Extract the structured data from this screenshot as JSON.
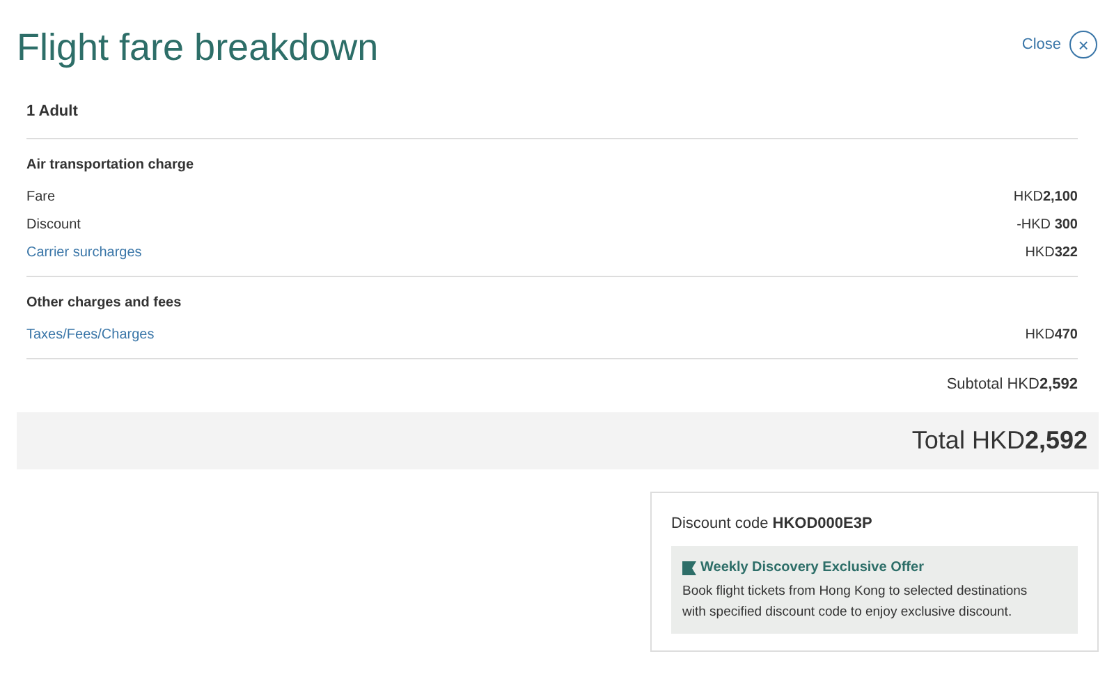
{
  "title": "Flight fare breakdown",
  "close": {
    "label": "Close",
    "icon": "×"
  },
  "passengers": "1 Adult",
  "sections": [
    {
      "heading": "Air transportation charge",
      "rows": [
        {
          "kind": "plain",
          "label": "Fare",
          "amount": "HKD**2,100**"
        },
        {
          "kind": "plain",
          "label": "Discount",
          "amount": "-HKD **300**"
        },
        {
          "kind": "link",
          "label": "Carrier surcharges",
          "amount": "HKD**322**"
        }
      ]
    },
    {
      "heading": "Other charges and fees",
      "rows": [
        {
          "kind": "link",
          "label": "Taxes/Fees/Charges",
          "amount": "HKD**470**"
        }
      ]
    }
  ],
  "subtotal": "Subtotal HKD**2,592**",
  "total": "Total HKD**2,592**",
  "discount": {
    "code": "Discount code **HKOD000E3P**",
    "offer_title": "Weekly Discovery Exclusive Offer",
    "offer_text": "Book flight tickets from Hong Kong to selected destinations with specified discount code to enjoy exclusive discount."
  }
}
